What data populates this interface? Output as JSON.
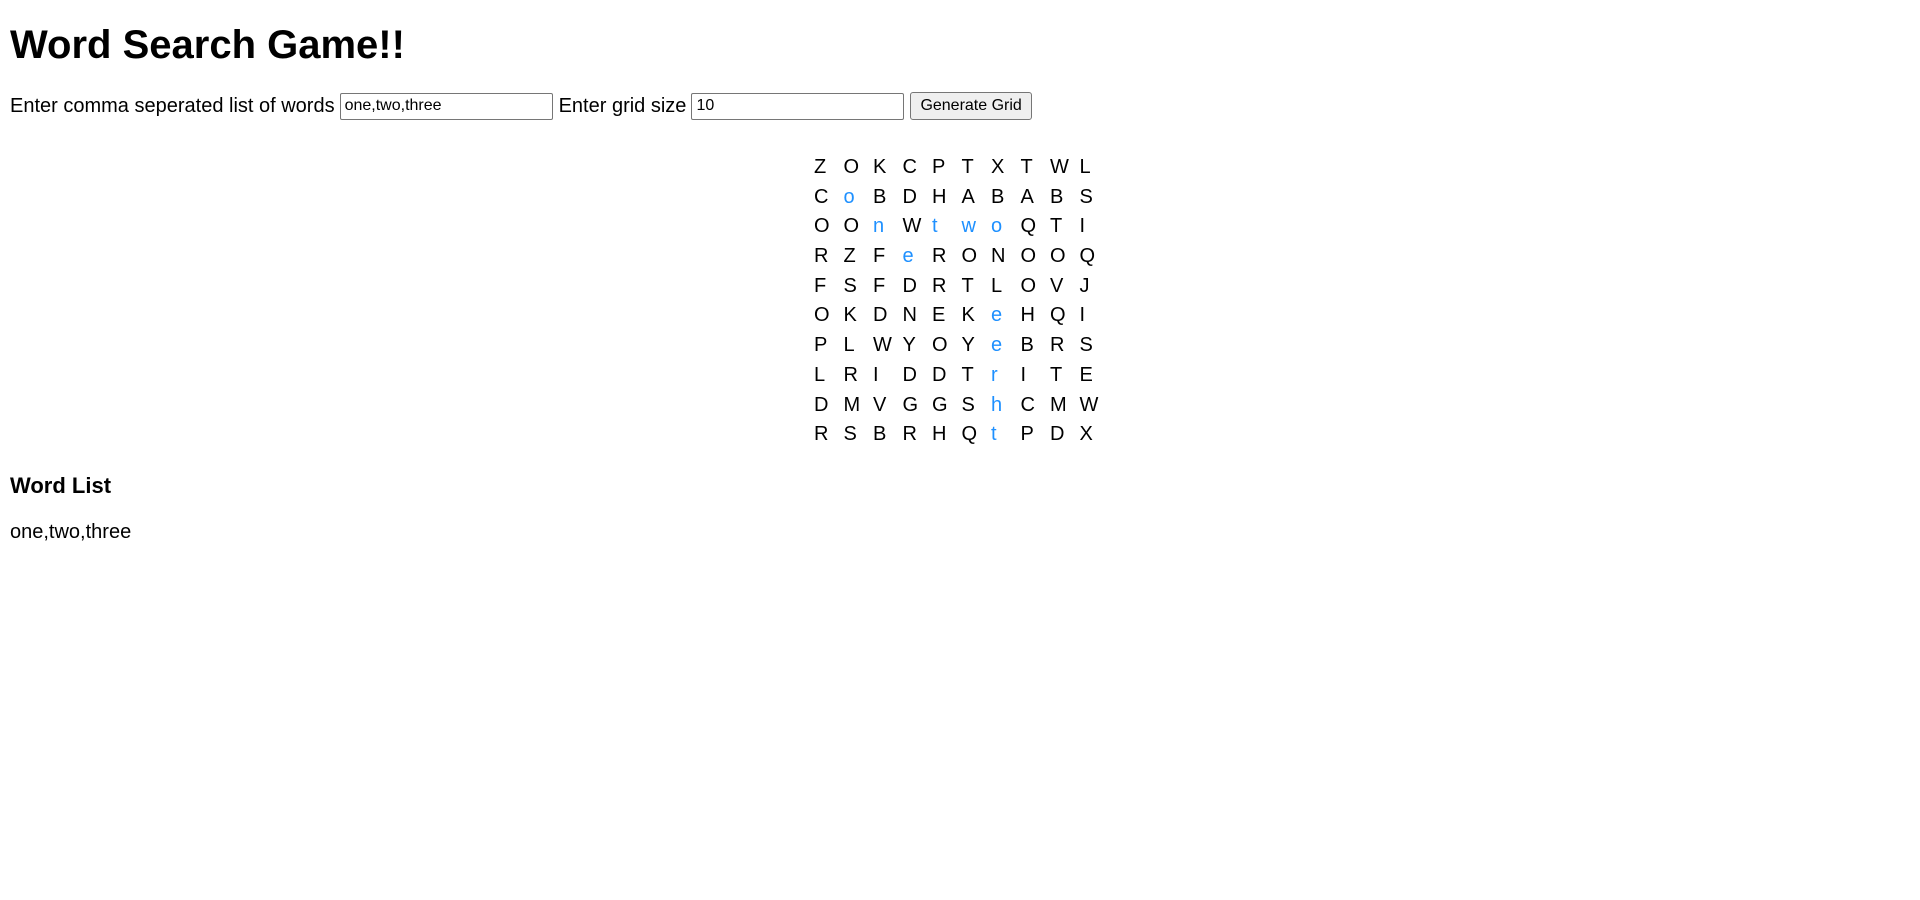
{
  "page": {
    "title": "Word Search Game!!"
  },
  "controls": {
    "words_label": "Enter comma seperated list of words",
    "words_value": "one,two,three",
    "size_label": "Enter grid size",
    "size_value": "10",
    "generate_button": "Generate Grid"
  },
  "colors": {
    "highlight": "#1e90ff",
    "text": "#000000"
  },
  "grid": {
    "rows": [
      [
        "Z",
        "O",
        "K",
        "C",
        "P",
        "T",
        "X",
        "T",
        "W",
        "L"
      ],
      [
        "C",
        "o",
        "B",
        "D",
        "H",
        "A",
        "B",
        "A",
        "B",
        "S"
      ],
      [
        "O",
        "O",
        "n",
        "W",
        "t",
        "w",
        "o",
        "Q",
        "T",
        "I"
      ],
      [
        "R",
        "Z",
        "F",
        "e",
        "R",
        "O",
        "N",
        "O",
        "O",
        "Q"
      ],
      [
        "F",
        "S",
        "F",
        "D",
        "R",
        "T",
        "L",
        "O",
        "V",
        "J"
      ],
      [
        "O",
        "K",
        "D",
        "N",
        "E",
        "K",
        "e",
        "H",
        "Q",
        "I"
      ],
      [
        "P",
        "L",
        "W",
        "Y",
        "O",
        "Y",
        "e",
        "B",
        "R",
        "S"
      ],
      [
        "L",
        "R",
        "I",
        "D",
        "D",
        "T",
        "r",
        "I",
        "T",
        "E"
      ],
      [
        "D",
        "M",
        "V",
        "G",
        "G",
        "S",
        "h",
        "C",
        "M",
        "W"
      ],
      [
        "R",
        "S",
        "B",
        "R",
        "H",
        "Q",
        "t",
        "P",
        "D",
        "X"
      ]
    ],
    "highlighted": [
      [
        1,
        1
      ],
      [
        2,
        2
      ],
      [
        3,
        3
      ],
      [
        2,
        4
      ],
      [
        2,
        5
      ],
      [
        2,
        6
      ],
      [
        5,
        6
      ],
      [
        6,
        6
      ],
      [
        7,
        6
      ],
      [
        8,
        6
      ],
      [
        9,
        6
      ]
    ]
  },
  "word_list": {
    "heading": "Word List",
    "text": "one,two,three"
  }
}
